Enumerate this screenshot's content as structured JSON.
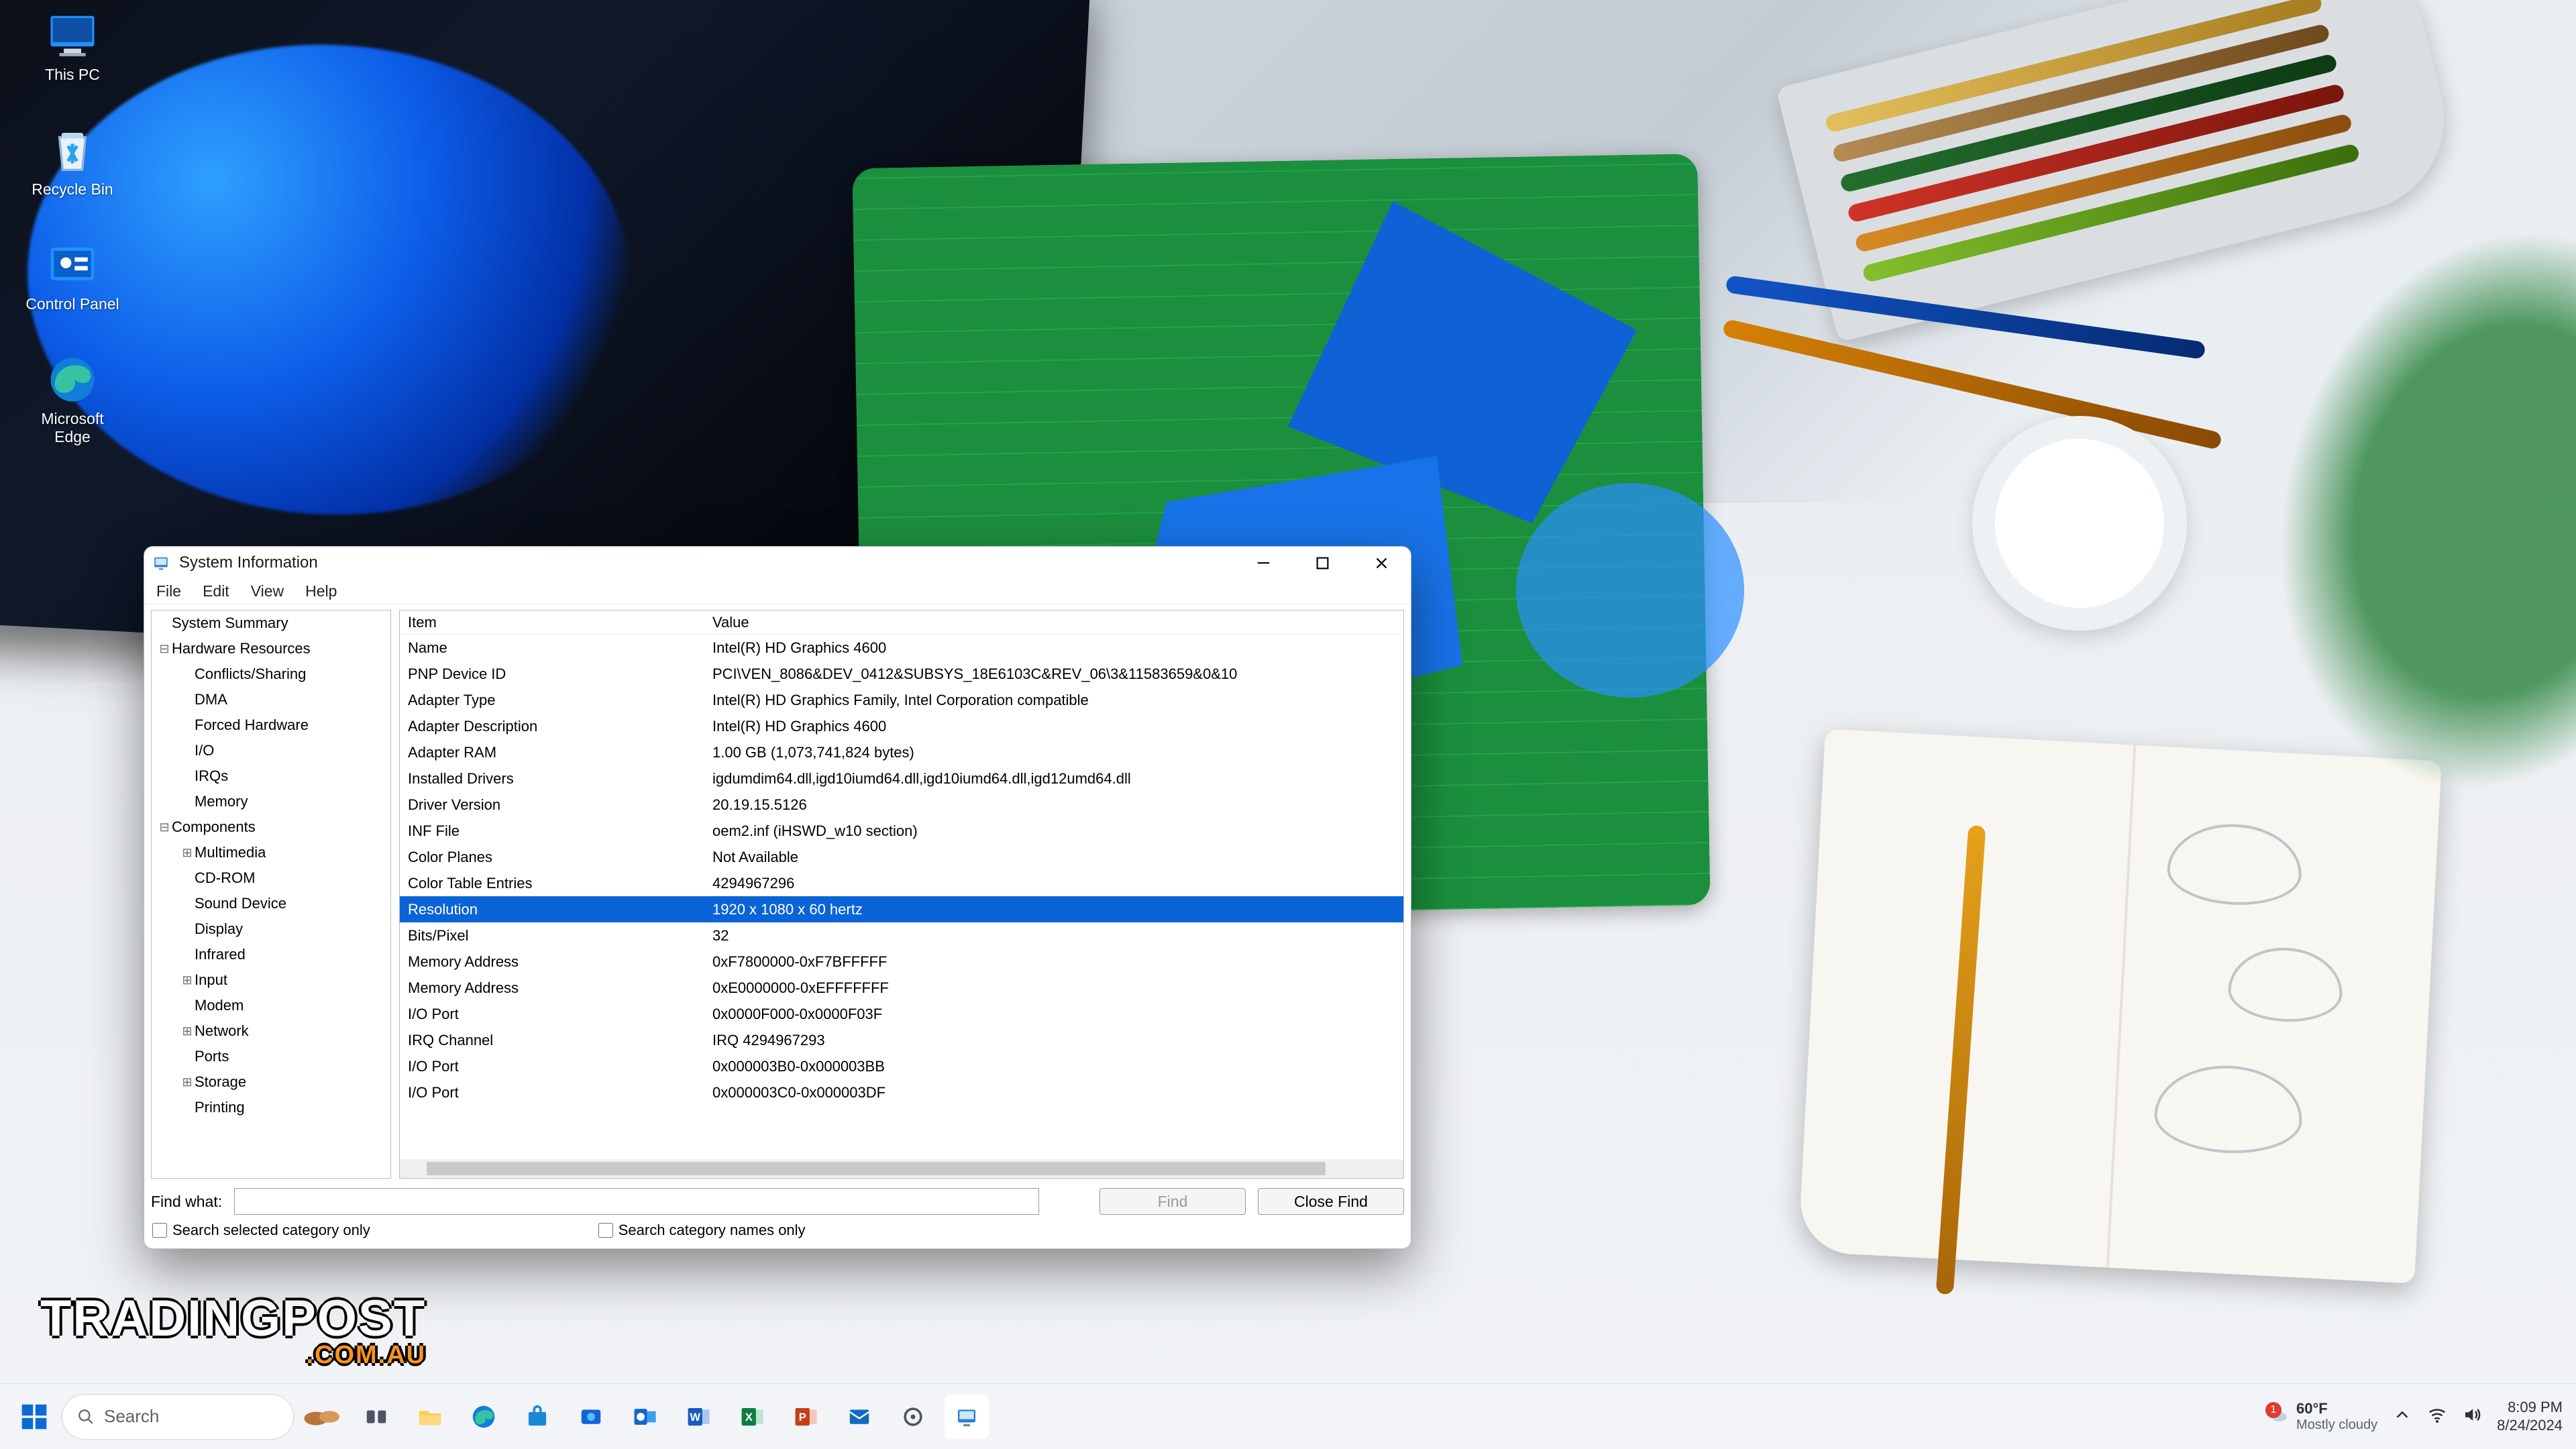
{
  "desktop_icons": [
    {
      "id": "this-pc",
      "label": "This PC"
    },
    {
      "id": "recycle-bin",
      "label": "Recycle Bin"
    },
    {
      "id": "control-panel",
      "label": "Control Panel"
    },
    {
      "id": "microsoft-edge",
      "label": "Microsoft\nEdge"
    }
  ],
  "watermark": {
    "main": "TRADINGPOST",
    "sub": ".COM.AU"
  },
  "window": {
    "title": "System Information",
    "menu": [
      "File",
      "Edit",
      "View",
      "Help"
    ],
    "tree": [
      {
        "depth": 0,
        "expander": "",
        "label": "System Summary"
      },
      {
        "depth": 0,
        "expander": "⊟",
        "label": "Hardware Resources"
      },
      {
        "depth": 1,
        "expander": "",
        "label": "Conflicts/Sharing"
      },
      {
        "depth": 1,
        "expander": "",
        "label": "DMA"
      },
      {
        "depth": 1,
        "expander": "",
        "label": "Forced Hardware"
      },
      {
        "depth": 1,
        "expander": "",
        "label": "I/O"
      },
      {
        "depth": 1,
        "expander": "",
        "label": "IRQs"
      },
      {
        "depth": 1,
        "expander": "",
        "label": "Memory"
      },
      {
        "depth": 0,
        "expander": "⊟",
        "label": "Components"
      },
      {
        "depth": 1,
        "expander": "⊞",
        "label": "Multimedia"
      },
      {
        "depth": 1,
        "expander": "",
        "label": "CD-ROM"
      },
      {
        "depth": 1,
        "expander": "",
        "label": "Sound Device"
      },
      {
        "depth": 1,
        "expander": "",
        "label": "Display"
      },
      {
        "depth": 1,
        "expander": "",
        "label": "Infrared"
      },
      {
        "depth": 1,
        "expander": "⊞",
        "label": "Input"
      },
      {
        "depth": 1,
        "expander": "",
        "label": "Modem"
      },
      {
        "depth": 1,
        "expander": "⊞",
        "label": "Network"
      },
      {
        "depth": 1,
        "expander": "",
        "label": "Ports"
      },
      {
        "depth": 1,
        "expander": "⊞",
        "label": "Storage"
      },
      {
        "depth": 1,
        "expander": "",
        "label": "Printing"
      }
    ],
    "detail_headers": {
      "c1": "Item",
      "c2": "Value"
    },
    "detail_rows": [
      {
        "item": "Name",
        "value": "Intel(R) HD Graphics 4600",
        "sel": false
      },
      {
        "item": "PNP Device ID",
        "value": "PCI\\VEN_8086&DEV_0412&SUBSYS_18E6103C&REV_06\\3&11583659&0&10",
        "sel": false
      },
      {
        "item": "Adapter Type",
        "value": "Intel(R) HD Graphics Family, Intel Corporation compatible",
        "sel": false
      },
      {
        "item": "Adapter Description",
        "value": "Intel(R) HD Graphics 4600",
        "sel": false
      },
      {
        "item": "Adapter RAM",
        "value": "1.00 GB (1,073,741,824 bytes)",
        "sel": false
      },
      {
        "item": "Installed Drivers",
        "value": "igdumdim64.dll,igd10iumd64.dll,igd10iumd64.dll,igd12umd64.dll",
        "sel": false
      },
      {
        "item": "Driver Version",
        "value": "20.19.15.5126",
        "sel": false
      },
      {
        "item": "INF File",
        "value": "oem2.inf (iHSWD_w10 section)",
        "sel": false
      },
      {
        "item": "Color Planes",
        "value": "Not Available",
        "sel": false
      },
      {
        "item": "Color Table Entries",
        "value": "4294967296",
        "sel": false
      },
      {
        "item": "Resolution",
        "value": "1920 x 1080 x 60 hertz",
        "sel": true
      },
      {
        "item": "Bits/Pixel",
        "value": "32",
        "sel": false
      },
      {
        "item": "Memory Address",
        "value": "0xF7800000-0xF7BFFFFF",
        "sel": false
      },
      {
        "item": "Memory Address",
        "value": "0xE0000000-0xEFFFFFFF",
        "sel": false
      },
      {
        "item": "I/O Port",
        "value": "0x0000F000-0x0000F03F",
        "sel": false
      },
      {
        "item": "IRQ Channel",
        "value": "IRQ 4294967293",
        "sel": false
      },
      {
        "item": "I/O Port",
        "value": "0x000003B0-0x000003BB",
        "sel": false
      },
      {
        "item": "I/O Port",
        "value": "0x000003C0-0x000003DF",
        "sel": false
      }
    ],
    "find": {
      "label": "Find what:",
      "value": "",
      "find_btn": "Find",
      "close_btn": "Close Find",
      "check1": "Search selected category only",
      "check2": "Search category names only"
    }
  },
  "taskbar": {
    "search_placeholder": "Search",
    "weather": {
      "temp": "60°F",
      "desc": "Mostly cloudy",
      "badge": "1"
    },
    "time": "8:09 PM",
    "date": "8/24/2024"
  }
}
